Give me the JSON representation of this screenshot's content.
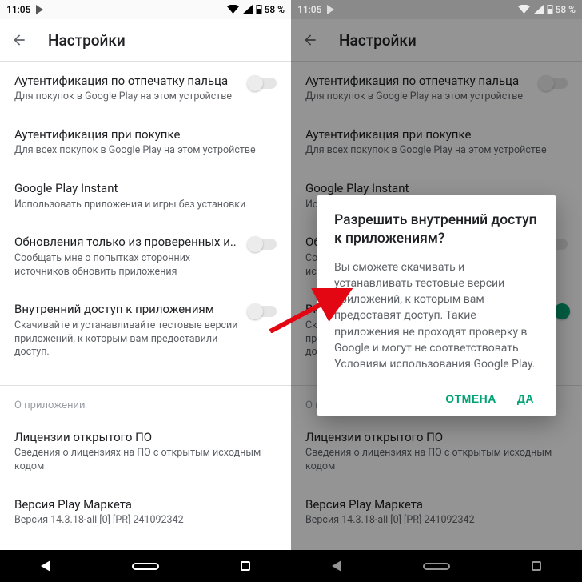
{
  "status": {
    "time": "11:05",
    "battery": "58 %"
  },
  "appbar": {
    "title": "Настройки"
  },
  "items": {
    "fp_auth": {
      "title": "Аутентификация по отпечатку пальца",
      "sub": "Для покупок в Google Play на этом устройстве"
    },
    "buy_auth": {
      "title": "Аутентификация при покупке",
      "sub": "Для всех покупок в Google Play на этом устройстве"
    },
    "instant": {
      "title": "Google Play Instant",
      "sub": "Использовать приложения и игры без установки"
    },
    "verified": {
      "title": "Обновления только из проверенных и..",
      "sub": "Сообщать мне о попытках сторонних источников обновить приложения"
    },
    "internal": {
      "title": "Внутренний доступ к приложениям",
      "sub": "Скачивайте и устанавливайте тестовые версии приложений, к которым вам предоставили доступ."
    },
    "about": {
      "title": "О приложении"
    },
    "licenses": {
      "title": "Лицензии открытого ПО",
      "sub": "Сведения о лицензиях на ПО с открытым исходным кодом"
    },
    "version": {
      "title": "Версия Play Маркета",
      "sub": "Версия 14.3.18-all [0] [PR] 241092342"
    }
  },
  "dialog": {
    "title": "Разрешить внутренний доступ к приложениям?",
    "body": "Вы сможете скачивать и устанавливать тестовые версии приложений, к которым вам предоставят доступ. Такие приложения не проходят проверку в Google и могут не соответствовать Условиям использования Google Play.",
    "cancel": "ОТМЕНА",
    "ok": "ДА"
  }
}
